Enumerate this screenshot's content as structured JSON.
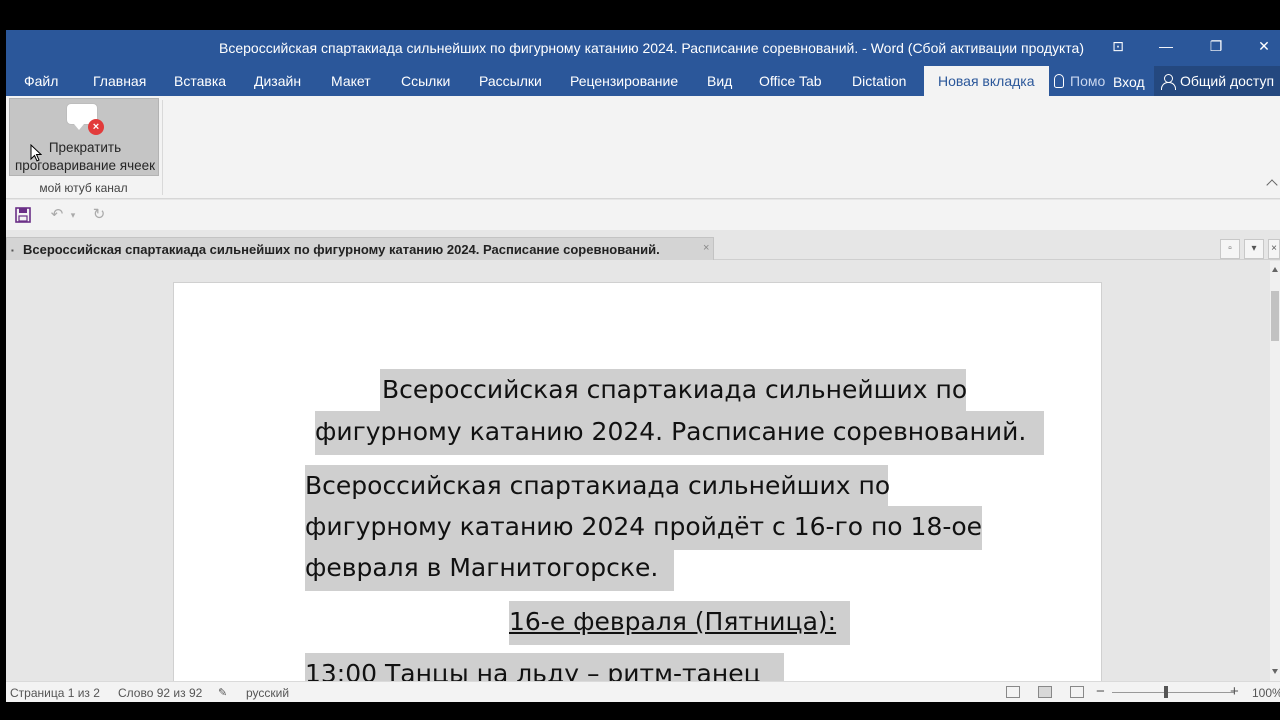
{
  "window": {
    "title": "Всероссийская спартакиада сильнейших по фигурному катанию 2024. Расписание соревнований. - Word (Сбой активации продукта)"
  },
  "tabs": [
    "Файл",
    "Главная",
    "Вставка",
    "Дизайн",
    "Макет",
    "Ссылки",
    "Рассылки",
    "Рецензирование",
    "Вид",
    "Office Tab",
    "Dictation",
    "Новая вкладка"
  ],
  "tell_me": "Помо",
  "sign_in": "Вход",
  "share": "Общий доступ",
  "ribbon": {
    "button_line1": "Прекратить",
    "button_line2": "проговаривание ячеек",
    "group_label": "мой ютуб канал"
  },
  "doc_tab": {
    "name": "Всероссийская спартакиада сильнейших по фигурному катанию 2024. Расписание соревнований.",
    "close": "×"
  },
  "document": {
    "title_line1": "Всероссийская спартакиада сильнейших по",
    "title_line2": "фигурному катанию 2024. Расписание соревнований.",
    "para_line1": "Всероссийская спартакиада сильнейших по",
    "para_line2": "фигурному катанию 2024 пройдёт с 16-го по 18-ое",
    "para_line3": "февраля в Магнитогорске.",
    "day_heading": "16-е февраля (Пятница):",
    "event_line": "13:00 Танцы на льду – ритм-танец"
  },
  "status": {
    "page": "Страница 1 из 2",
    "words": "Слово 92 из 92",
    "language": "русский",
    "zoom": "100%"
  },
  "colors": {
    "accent": "#2b579a",
    "highlight": "#cfcfcf"
  }
}
